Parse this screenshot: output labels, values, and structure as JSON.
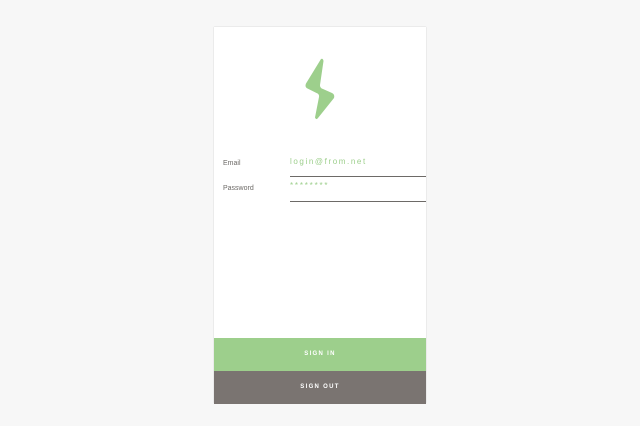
{
  "form": {
    "email_label": "Email",
    "email_value": "login@from.net",
    "password_label": "Password",
    "password_value": "********"
  },
  "actions": {
    "sign_in_label": "SIGN IN",
    "sign_out_label": "SIGN OUT"
  },
  "icons": {
    "logo": "lightning-bolt-icon"
  },
  "colors": {
    "accent": "#9dcf8c",
    "secondary": "#7a7471",
    "text": "#6d6a67",
    "background": "#f7f7f7",
    "card": "#ffffff"
  }
}
